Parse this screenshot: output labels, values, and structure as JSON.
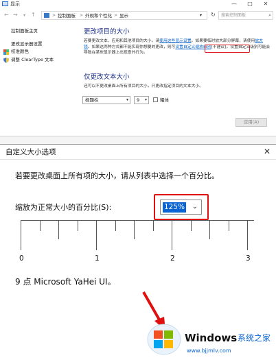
{
  "window": {
    "title": "显示",
    "controls": {
      "minimize": "—",
      "maximize": "□",
      "close": "✕"
    }
  },
  "address": {
    "back": "←",
    "forward": "→",
    "up": "↑",
    "crumbs": [
      "控制面板",
      "外观和个性化",
      "显示"
    ],
    "separator": ">",
    "refresh": "↻",
    "search_placeholder": "搜索控制面板"
  },
  "left_nav": {
    "home": "控制面板主页",
    "links": [
      "更改显示器设置",
      "校准颜色",
      "调整 ClearType 文本"
    ]
  },
  "main": {
    "size_heading": "更改项目的大小",
    "size_desc_parts": [
      "若要更改文本、应用和其他项目的大小，请",
      "使用这些显示设置",
      "。如果要临时放大部分屏幕，请使用",
      "放大镜",
      "。如果这两种方式都不能实现你想要的更改，则可",
      "设置自定义缩放级别",
      "(不建议)。设置自定义级别可能会导致在某些显示器上出现意外行为。"
    ],
    "text_heading": "仅更改文本大小",
    "text_desc": "还可以不更改桌面上所有项目的大小，只更改指定项目的文本大小。",
    "item_select": "标题栏",
    "size_select": "9",
    "bold_label": "粗体",
    "apply_button": "应用(A)"
  },
  "dialog": {
    "title": "自定义大小选项",
    "close": "✕",
    "instruction": "若要更改桌面上所有项的大小，请从列表中选择一个百分比。",
    "scale_label": "缩放为正常大小的百分比(S):",
    "scale_value": "125%",
    "ruler_labels": [
      "0",
      "1",
      "2",
      "3"
    ],
    "sample_text": "9 点 Microsoft YaHei UI。"
  },
  "watermark": {
    "brand": "Windows",
    "brand_cn": "系统之家",
    "url": "www.bjjmlv.com"
  },
  "colors": {
    "heading_blue": "#1e3287",
    "link_blue": "#0b63c5",
    "highlight_red": "#e02020",
    "selection_blue": "#0a64d4"
  }
}
